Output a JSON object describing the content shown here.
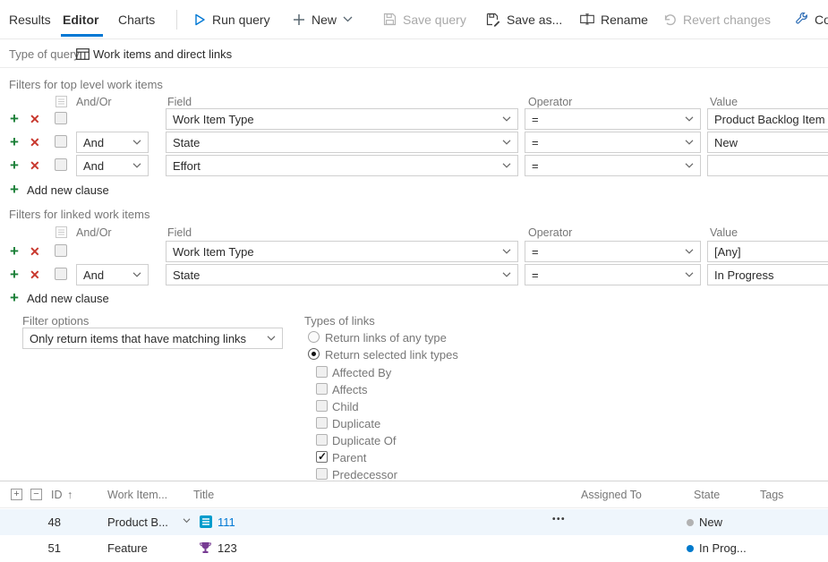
{
  "toolbar": {
    "tabs": {
      "results": "Results",
      "editor": "Editor",
      "charts": "Charts"
    },
    "run_query": "Run query",
    "new_btn": "New",
    "save_query": "Save query",
    "save_as": "Save as...",
    "rename": "Rename",
    "revert": "Revert changes",
    "column_options": "Col"
  },
  "query_type": {
    "label": "Type of query",
    "value": "Work items and direct links"
  },
  "top_filters": {
    "title": "Filters for top level work items",
    "columns": {
      "andor": "And/Or",
      "field": "Field",
      "operator": "Operator",
      "value": "Value"
    },
    "rows": [
      {
        "andor": "",
        "field": "Work Item Type",
        "operator": "=",
        "value": "Product Backlog Item"
      },
      {
        "andor": "And",
        "field": "State",
        "operator": "=",
        "value": "New"
      },
      {
        "andor": "And",
        "field": "Effort",
        "operator": "=",
        "value": ""
      }
    ],
    "add_clause": "Add new clause"
  },
  "linked_filters": {
    "title": "Filters for linked work items",
    "columns": {
      "andor": "And/Or",
      "field": "Field",
      "operator": "Operator",
      "value": "Value"
    },
    "rows": [
      {
        "andor": "",
        "field": "Work Item Type",
        "operator": "=",
        "value": "[Any]"
      },
      {
        "andor": "And",
        "field": "State",
        "operator": "=",
        "value": "In Progress"
      }
    ],
    "add_clause": "Add new clause"
  },
  "filter_options": {
    "label": "Filter options",
    "value": "Only return items that have matching links"
  },
  "link_types": {
    "label": "Types of links",
    "radio_any": {
      "label": "Return links of any type",
      "selected": false
    },
    "radio_selected": {
      "label": "Return selected link types",
      "selected": true
    },
    "checkboxes": [
      {
        "label": "Affected By",
        "checked": false
      },
      {
        "label": "Affects",
        "checked": false
      },
      {
        "label": "Child",
        "checked": false
      },
      {
        "label": "Duplicate",
        "checked": false
      },
      {
        "label": "Duplicate Of",
        "checked": false
      },
      {
        "label": "Parent",
        "checked": true
      },
      {
        "label": "Predecessor",
        "checked": false
      }
    ]
  },
  "results_grid": {
    "columns": {
      "id": "ID",
      "sort_arrow": "↑",
      "work_item_type": "Work Item...",
      "title": "Title",
      "assigned_to": "Assigned To",
      "state": "State",
      "tags": "Tags"
    },
    "rows": [
      {
        "id": "48",
        "work_item_type": "Product B...",
        "title": "111",
        "actions": "•••",
        "state": "New",
        "selected": true,
        "type_icon": "product-backlog-item",
        "state_dot": "#b2b2b2"
      },
      {
        "id": "51",
        "work_item_type": "Feature",
        "title": "123",
        "actions": "",
        "state": "In Prog...",
        "selected": false,
        "type_icon": "feature-trophy",
        "state_dot": "#007acc"
      }
    ]
  },
  "colors": {
    "accent_blue": "#0078d4",
    "pbi_icon": "#009ccc",
    "feature_icon": "#773b93",
    "state_new_dot": "#b2b2b2",
    "state_inprogress_dot": "#007acc",
    "add_green": "#1a7f37",
    "remove_red": "#c8372d"
  }
}
